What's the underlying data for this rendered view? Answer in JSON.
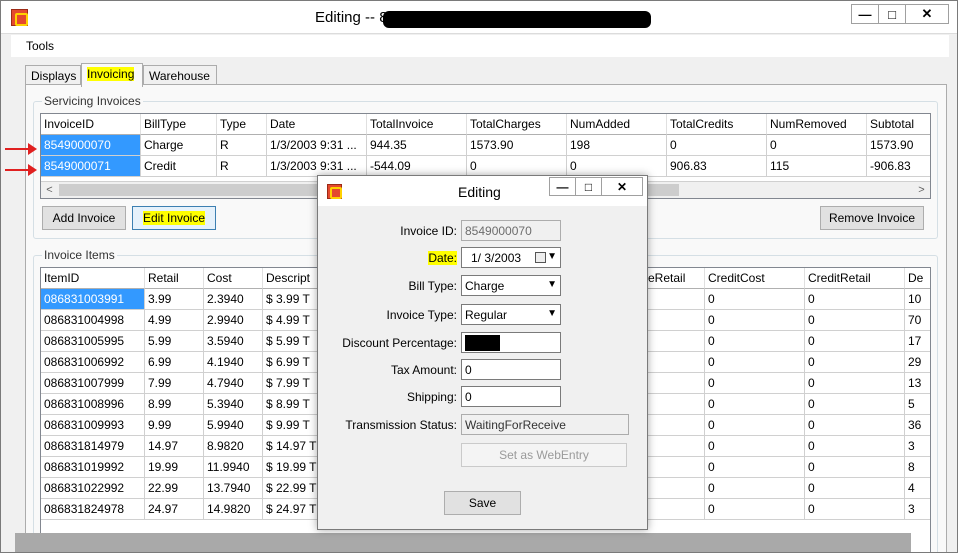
{
  "window": {
    "title_prefix": "Editing -- 85",
    "controls": {
      "minimize": "—",
      "maximize": "□",
      "close": "✕"
    }
  },
  "menu": {
    "items": [
      "Tools"
    ]
  },
  "tabs": [
    {
      "label": "Displays"
    },
    {
      "label": "Invoicing",
      "active": true,
      "highlighted": true
    },
    {
      "label": "Warehouse"
    }
  ],
  "servicing": {
    "group_title": "Servicing Invoices",
    "columns": [
      "InvoiceID",
      "BillType",
      "Type",
      "Date",
      "TotalInvoice",
      "TotalCharges",
      "NumAdded",
      "TotalCredits",
      "NumRemoved",
      "Subtotal"
    ],
    "rows": [
      [
        "8549000070",
        "Charge",
        "R",
        "1/3/2003 9:31 ...",
        "944.35",
        "1573.90",
        "198",
        "0",
        "0",
        "1573.90"
      ],
      [
        "8549000071",
        "Credit",
        "R",
        "1/3/2003 9:31 ...",
        "-544.09",
        "0",
        "0",
        "906.83",
        "115",
        "-906.83"
      ]
    ],
    "buttons": {
      "add": "Add Invoice",
      "edit": "Edit Invoice",
      "remove": "Remove Invoice"
    }
  },
  "items": {
    "group_title": "Invoice Items",
    "columns": [
      "ItemID",
      "Retail",
      "Cost",
      "Descript",
      "eRetail",
      "CreditCost",
      "CreditRetail",
      "De"
    ],
    "rows": [
      [
        "086831003991",
        "3.99",
        "2.3940",
        "$ 3.99 T",
        "",
        "0",
        "0",
        "10"
      ],
      [
        "086831004998",
        "4.99",
        "2.9940",
        "$ 4.99 T",
        "",
        "0",
        "0",
        "70"
      ],
      [
        "086831005995",
        "5.99",
        "3.5940",
        "$ 5.99 T",
        "",
        "0",
        "0",
        "17"
      ],
      [
        "086831006992",
        "6.99",
        "4.1940",
        "$ 6.99 T",
        "",
        "0",
        "0",
        "29"
      ],
      [
        "086831007999",
        "7.99",
        "4.7940",
        "$ 7.99 T",
        "",
        "0",
        "0",
        "13"
      ],
      [
        "086831008996",
        "8.99",
        "5.3940",
        "$ 8.99 T",
        "",
        "0",
        "0",
        "5"
      ],
      [
        "086831009993",
        "9.99",
        "5.9940",
        "$ 9.99 T",
        "",
        "0",
        "0",
        "36"
      ],
      [
        "086831814979",
        "14.97",
        "8.9820",
        "$ 14.97 T",
        "",
        "0",
        "0",
        "3"
      ],
      [
        "086831019992",
        "19.99",
        "11.9940",
        "$ 19.99 T",
        "",
        "0",
        "0",
        "8"
      ],
      [
        "086831022992",
        "22.99",
        "13.7940",
        "$ 22.99 T",
        "",
        "0",
        "0",
        "4"
      ],
      [
        "086831824978",
        "24.97",
        "14.9820",
        "$ 24.97 T",
        "",
        "0",
        "0",
        "3"
      ]
    ]
  },
  "dialog": {
    "title": "Editing",
    "controls": {
      "minimize": "—",
      "maximize": "□",
      "close": "✕"
    },
    "fields": {
      "invoice_id": {
        "label": "Invoice ID:",
        "value": "8549000070"
      },
      "date": {
        "label": "Date:",
        "value": "1/  3/2003"
      },
      "bill_type": {
        "label": "Bill Type:",
        "value": "Charge"
      },
      "invoice_type": {
        "label": "Invoice Type:",
        "value": "Regular"
      },
      "discount": {
        "label": "Discount Percentage:"
      },
      "tax": {
        "label": "Tax Amount:",
        "value": "0"
      },
      "shipping": {
        "label": "Shipping:",
        "value": "0"
      },
      "transmission": {
        "label": "Transmission Status:",
        "value": "WaitingForReceive"
      }
    },
    "webentry_button": "Set as WebEntry",
    "save_button": "Save"
  },
  "colors": {
    "selection": "#3399ff",
    "highlight": "#ffff00",
    "annotation_arrow": "#e02020"
  }
}
